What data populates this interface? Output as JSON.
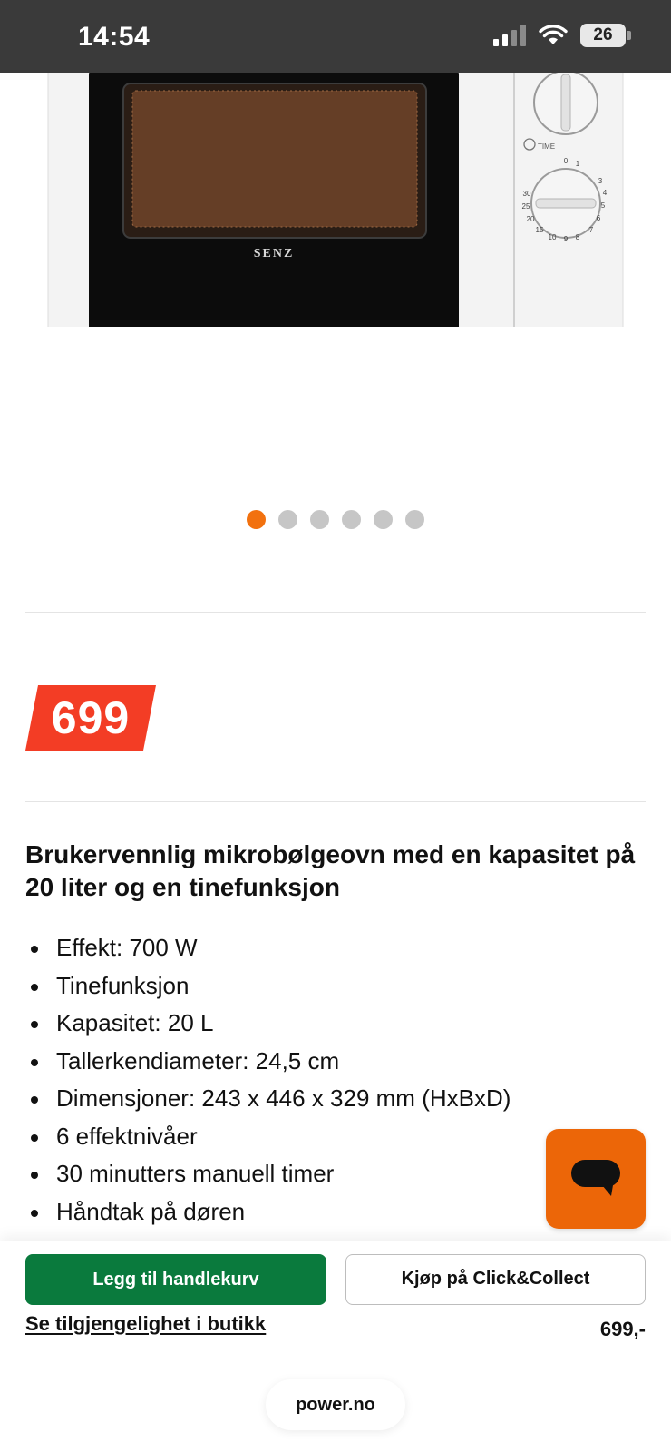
{
  "status_bar": {
    "time": "14:54",
    "battery": "26"
  },
  "product_image": {
    "brand_text": "SENZ",
    "timer_label": "TIME"
  },
  "carousel": {
    "total": 6,
    "active_index": 0,
    "active_color": "#f2710f"
  },
  "price": {
    "badge": "699",
    "badge_color": "#f33d25"
  },
  "product": {
    "headline": "Brukervennlig mikrobølgeovn med en kapasitet på 20 liter og en tinefunksjon",
    "features": [
      "Effekt: 700 W",
      "Tinefunksjon",
      "Kapasitet: 20 L",
      "Tallerkendiameter: 24,5 cm",
      "Dimensjoner: 243 x 446 x 329 mm (HxBxD)",
      "6 effektnivåer",
      "30 minutters manuell timer",
      "Håndtak på døren"
    ]
  },
  "chat": {
    "icon": "chat-bubble-icon",
    "color": "#ec6608"
  },
  "actions": {
    "add_to_cart": "Legg til handlekurv",
    "click_collect": "Kjøp på Click&Collect",
    "availability": "Se tilgjengelighet i butikk",
    "price": "699,-"
  },
  "browser": {
    "url": "power.no"
  }
}
